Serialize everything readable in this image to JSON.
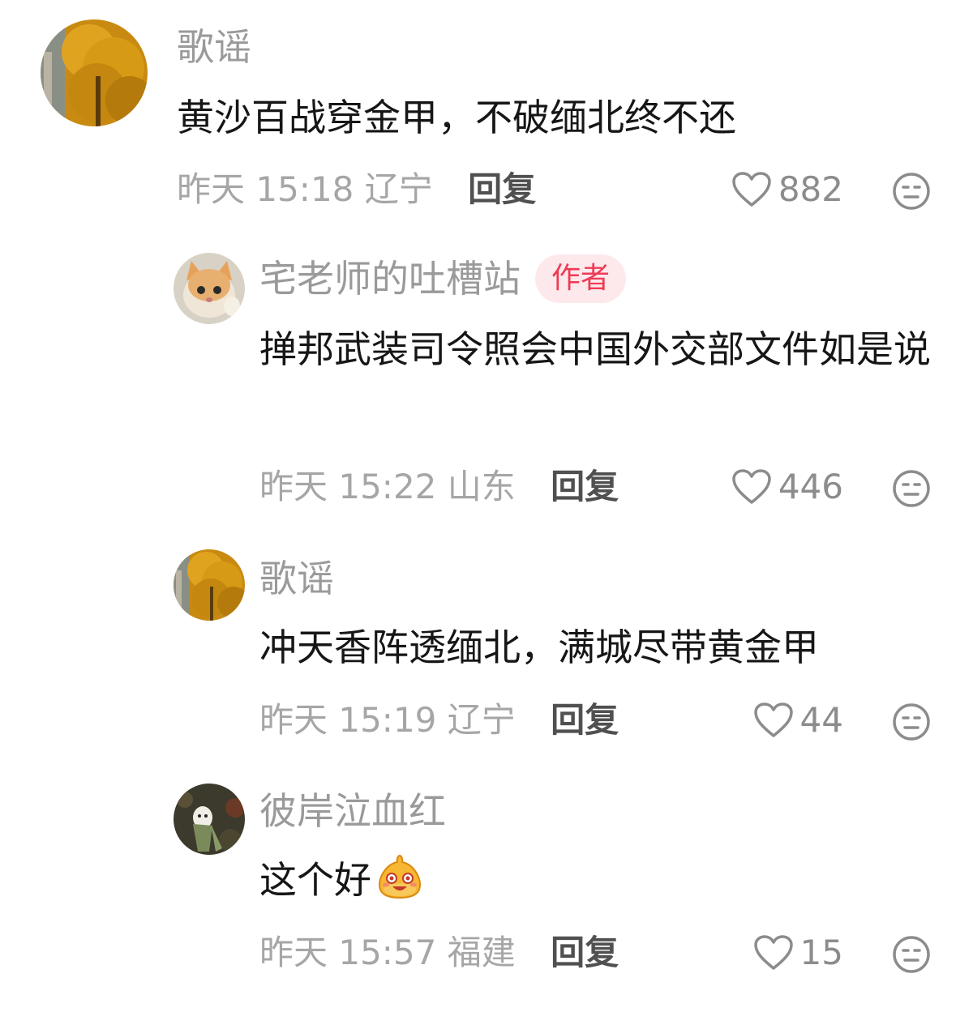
{
  "comments": [
    {
      "name": "歌谣",
      "text": "黄沙百战穿金甲，不破缅北终不还",
      "date": "昨天 15:18",
      "location": "辽宁",
      "reply": "回复",
      "likes": "882",
      "avatar_icon": "ginkgo-tree-avatar"
    },
    {
      "name": "宅老师的吐槽站",
      "badge": "作者",
      "text": "掸邦武装司令照会中国外交部文件如是说",
      "date": "昨天 15:22",
      "location": "山东",
      "reply": "回复",
      "likes": "446",
      "avatar_icon": "kitten-avatar"
    },
    {
      "name": "歌谣",
      "text": "冲天香阵透缅北，满城尽带黄金甲",
      "date": "昨天 15:19",
      "location": "辽宁",
      "reply": "回复",
      "likes": "44",
      "avatar_icon": "ginkgo-tree-avatar"
    },
    {
      "name": "彼岸泣血红",
      "text": "这个好",
      "emoji": "happy-blob-emoji",
      "date": "昨天 15:57",
      "location": "福建",
      "reply": "回复",
      "likes": "15",
      "avatar_icon": "ghost-figure-avatar"
    }
  ],
  "colors": {
    "name_gray": "#9a9a9a",
    "text_dark": "#161616",
    "meta_gray": "#a6a6a6",
    "badge_bg": "#fde9ec",
    "badge_text": "#ef3b55"
  }
}
